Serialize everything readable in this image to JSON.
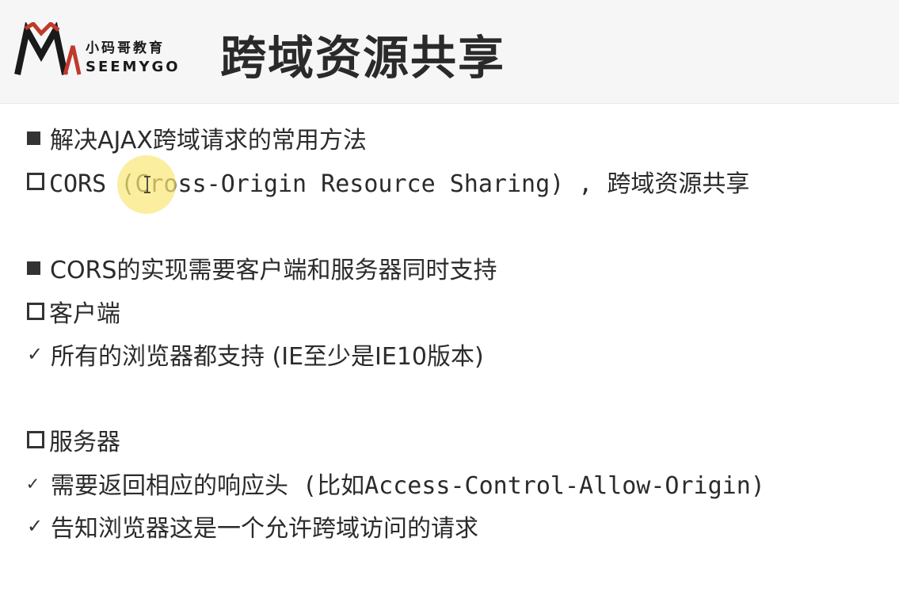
{
  "logo": {
    "cn": "小码哥教育",
    "en": "SEEMYGO",
    "color": "#c0392b"
  },
  "title": "跨域资源共享",
  "lines": [
    {
      "marker": "filled-square",
      "text": "解决AJAX跨域请求的常用方法"
    },
    {
      "marker": "hollow-square",
      "text": "CORS (Cross-Origin Resource Sharing) , 跨域资源共享"
    },
    {
      "marker": "filled-square",
      "text": "CORS的实现需要客户端和服务器同时支持"
    },
    {
      "marker": "hollow-square",
      "text": "客户端"
    },
    {
      "marker": "check",
      "text": "所有的浏览器都支持 (IE至少是IE10版本)"
    },
    {
      "marker": "hollow-square",
      "text": "服务器"
    },
    {
      "marker": "check",
      "text": "需要返回相应的响应头 (比如Access-Control-Allow-Origin)"
    },
    {
      "marker": "check",
      "text": "告知浏览器这是一个允许跨域访问的请求"
    }
  ],
  "icons": {
    "check": "✓",
    "cursor": "i-beam-cursor-icon"
  },
  "colors": {
    "header_bg": "#f6f6f6",
    "text": "#2b2b2b",
    "cursor_highlight": "#fae878"
  }
}
